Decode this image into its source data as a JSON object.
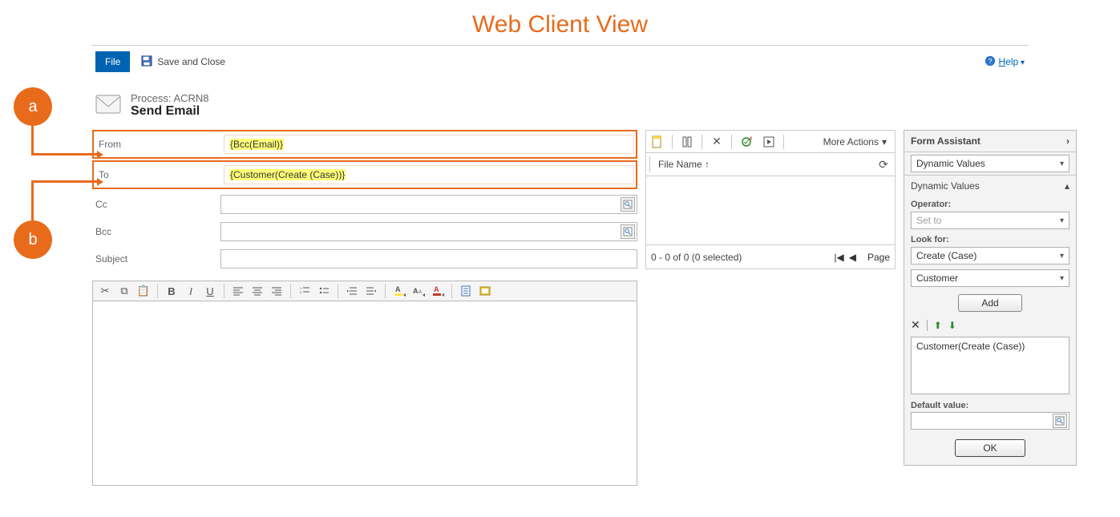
{
  "page": {
    "title": "Web Client View"
  },
  "toolbar": {
    "file": "File",
    "save_close": "Save and Close",
    "help": "Help"
  },
  "header": {
    "process_line": "Process: ACRN8",
    "form_title": "Send Email"
  },
  "callouts": {
    "a": "a",
    "b": "b"
  },
  "fields": {
    "from": {
      "label": "From",
      "value": "{Bcc(Email)}"
    },
    "to": {
      "label": "To",
      "value": "{Customer(Create (Case))}"
    },
    "cc": {
      "label": "Cc",
      "value": ""
    },
    "bcc": {
      "label": "Bcc",
      "value": ""
    },
    "subject": {
      "label": "Subject",
      "value": ""
    }
  },
  "attachments": {
    "more_actions": "More Actions",
    "col_file_name": "File Name ↑",
    "summary": "0 - 0 of 0 (0 selected)",
    "nav_first": "⏮",
    "nav_prev": "◀",
    "page_label": "Page"
  },
  "form_assistant": {
    "title": "Form Assistant",
    "section_select": "Dynamic Values",
    "sub_title": "Dynamic Values",
    "operator_label": "Operator:",
    "operator_value": "Set to",
    "lookfor_label": "Look for:",
    "lookfor_entity": "Create (Case)",
    "lookfor_attr": "Customer",
    "add_btn": "Add",
    "list_item_0": "Customer(Create (Case))",
    "default_label": "Default value:",
    "ok_btn": "OK"
  }
}
